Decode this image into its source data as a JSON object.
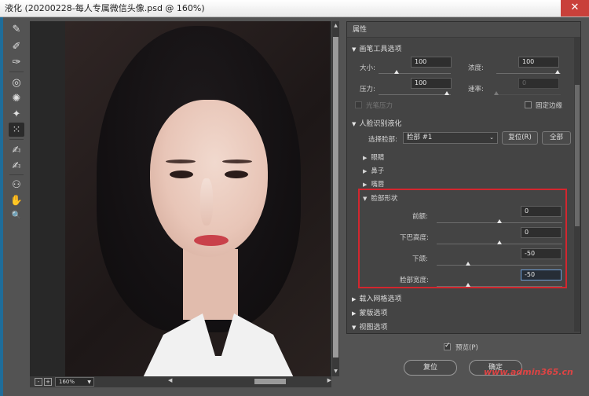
{
  "window": {
    "title": "液化 (20200228-每人专属微信头像.psd @ 160%)",
    "close_glyph": "✕"
  },
  "tools": [
    {
      "name": "forward-warp-tool-icon",
      "glyph": "✎"
    },
    {
      "name": "reconstruct-tool-icon",
      "glyph": "✐"
    },
    {
      "name": "smooth-tool-icon",
      "glyph": "✑"
    },
    {
      "name": "twirl-tool-icon",
      "glyph": "◎"
    },
    {
      "name": "pucker-tool-icon",
      "glyph": "✺"
    },
    {
      "name": "bloat-tool-icon",
      "glyph": "✦"
    },
    {
      "name": "push-left-tool-icon",
      "glyph": "⁙"
    },
    {
      "name": "freeze-mask-tool-icon",
      "glyph": "✍"
    },
    {
      "name": "thaw-mask-tool-icon",
      "glyph": "✍"
    },
    {
      "name": "face-tool-icon",
      "glyph": "⚇"
    },
    {
      "name": "hand-tool-icon",
      "glyph": "✋"
    },
    {
      "name": "zoom-tool-icon",
      "glyph": "🔍"
    }
  ],
  "status": {
    "zoom": "160%",
    "minus": "-",
    "plus": "+"
  },
  "panel": {
    "title": "属性",
    "brush": {
      "title": "画笔工具选项",
      "size_label": "大小:",
      "size_value": "100",
      "density_label": "浓度:",
      "density_value": "100",
      "pressure_label": "压力:",
      "pressure_value": "100",
      "rate_label": "速率:",
      "rate_value": "0",
      "stylus_label": "光笔压力",
      "pin_edges_label": "固定边缘"
    },
    "face": {
      "title": "人脸识别液化",
      "select_label": "选择脸部:",
      "select_value": "脸部 #1",
      "reset_label": "复位(R)",
      "all_label": "全部",
      "eyes": "眼睛",
      "nose": "鼻子",
      "mouth": "嘴唇",
      "shape_title": "脸部形状",
      "forehead_label": "前额:",
      "forehead_value": "0",
      "chin_label": "下巴高度:",
      "chin_value": "0",
      "jaw_label": "下颌:",
      "jaw_value": "-50",
      "width_label": "脸部宽度:",
      "width_value": "-50"
    },
    "mesh": "载入网格选项",
    "mask": "蒙版选项",
    "view": "视图选项"
  },
  "footer": {
    "preview_label": "预览(P)",
    "reset_label": "复位",
    "ok_label": "确定",
    "watermark": "www.admin365.cn"
  },
  "slider_levels": {
    "size": 0.25,
    "density": 0.95,
    "pressure": 0.95,
    "rate": 0.0,
    "forehead": 0.5,
    "chin": 0.5,
    "jaw": 0.25,
    "width": 0.25
  }
}
